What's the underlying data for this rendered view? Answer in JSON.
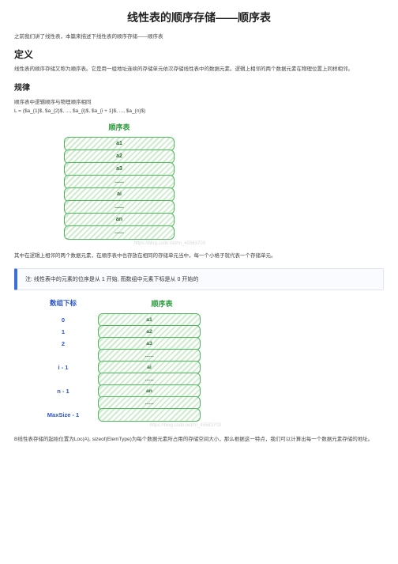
{
  "title": "线性表的顺序存储——顺序表",
  "intro": "之前我们讲了线性表，本篇来描述下线性表的顺序存储——顺序表",
  "defHeading": "定义",
  "defText": "线性表的顺序存储又称为顺序表。它是用一组地址连续的存储单元依次存储线性表中的数据元素。逻辑上相邻的两个数据元素在物理位置上同样相邻。",
  "ruleHeading": "规律",
  "ruleText1": "顺序表中逻辑顺序与物理顺序相同",
  "ruleText2": "L = ($a_{1}$, $a_{2}$, ..., $a_{i}$, $a_{i + 1}$, ..., $a_{n}$)",
  "fig1": {
    "title": "顺序表",
    "cells": [
      "a1",
      "a2",
      "a3",
      "......",
      "ai",
      "......",
      "an",
      "......"
    ],
    "watermark": "https://blog.csdn.net/m_45583703"
  },
  "midText": "其中在逻辑上相邻的两个数据元素，在顺序表中也存放在相同的存储单元当中，每一个小格子就代表一个存储单元。",
  "note": "注: 线性表中的元素的位序是从 1 开始, 而数组中元素下标是从 0 开始的",
  "fig2": {
    "idxTitle": "数组下标",
    "tblTitle": "顺序表",
    "rows": [
      {
        "idx": "0",
        "val": "a1"
      },
      {
        "idx": "1",
        "val": "a2"
      },
      {
        "idx": "2",
        "val": "a3"
      },
      {
        "idx": "",
        "val": "......"
      },
      {
        "idx": "i - 1",
        "val": "ai"
      },
      {
        "idx": "",
        "val": "......"
      },
      {
        "idx": "n - 1",
        "val": "an"
      },
      {
        "idx": "",
        "val": "......"
      },
      {
        "idx": "MaxSize - 1",
        "val": ""
      }
    ],
    "watermark": "https://blog.csdn.net/m_45583703"
  },
  "footer": "B线性表存储的起始位置为Loc(A), sizeof(ElemType)为每个数据元素所占用的存储空间大小，那么根据这一特点，我们可以计算出每一个数据元素存储的地址。"
}
